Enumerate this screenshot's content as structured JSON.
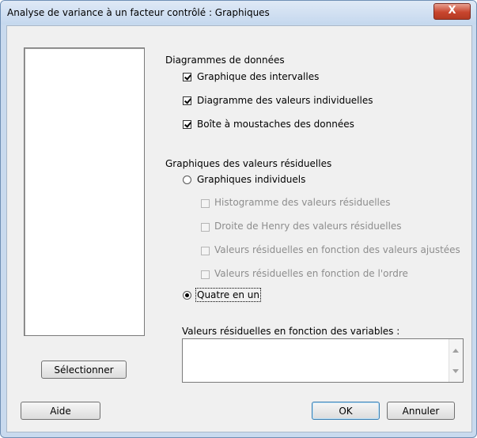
{
  "window": {
    "title": "Analyse de variance à un facteur contrôlé : Graphiques",
    "close_glyph": "X"
  },
  "data_plots": {
    "heading": "Diagrammes de données",
    "items": [
      {
        "label": "Graphique des intervalles",
        "checked": true
      },
      {
        "label": "Diagramme des valeurs individuelles",
        "checked": true
      },
      {
        "label": "Boîte à moustaches des données",
        "checked": true
      }
    ]
  },
  "residual_plots": {
    "heading": "Graphiques des valeurs résiduelles",
    "individual_label": "Graphiques individuels",
    "sub_items": [
      "Histogramme des valeurs résiduelles",
      "Droite de Henry des valeurs résiduelles",
      "Valeurs résiduelles en fonction des valeurs ajustées",
      "Valeurs résiduelles en fonction de l'ordre"
    ],
    "four_in_one_label": "Quatre en un",
    "selected": "four_in_one"
  },
  "residuals_vs_variables": {
    "label": "Valeurs résiduelles en fonction des variables :",
    "value": ""
  },
  "buttons": {
    "select": "Sélectionner",
    "help": "Aide",
    "ok": "OK",
    "cancel": "Annuler"
  },
  "colors": {
    "title_bar": "#c5d8ee",
    "close_button": "#c8452e",
    "dialog_bg": "#f0f0f0"
  }
}
